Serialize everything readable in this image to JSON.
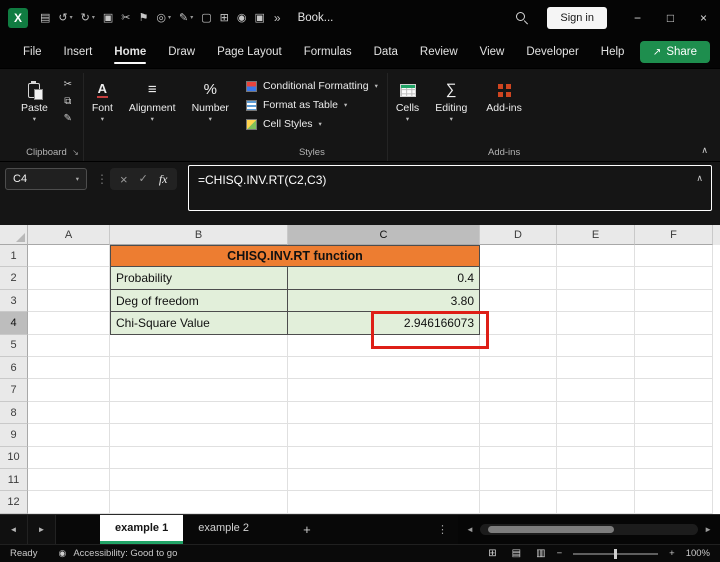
{
  "colors": {
    "excel_green": "#107C41",
    "share_green": "#1e8e4e",
    "title_orange": "#ED7D31",
    "cell_green": "#E2EFDA",
    "annotation_red": "#DE1F17",
    "tab_underline": "#21A366"
  },
  "icons": {
    "caret_down": "▾",
    "chevron_up": "∧",
    "dots_vertical": "⋮",
    "overflow": "»",
    "minimize": "−",
    "maximize": "□",
    "close": "×",
    "cancel": "×",
    "enter": "✓",
    "fx": "fx",
    "dialog_launcher": "↘",
    "nav_left": "◄",
    "nav_right": "►",
    "scroll_left": "◄",
    "scroll_right": "►",
    "add_sheet": "+",
    "zoom_out": "−",
    "zoom_in": "+",
    "share_arrow": "↗",
    "font_glyph": "A",
    "alignment_glyph": "≡",
    "number_glyph": "%",
    "editing_glyph": "∑",
    "accessibility_glyph": "◉",
    "view_normal": "⊞",
    "view_page_layout": "▤",
    "view_page_break": "▥"
  },
  "titlebar": {
    "logo_glyph": "X",
    "doc_title": "Book...",
    "sign_in_label": "Sign in",
    "quick_icons": [
      {
        "name": "save-icon",
        "glyph": "▤",
        "caret": false
      },
      {
        "name": "undo-icon",
        "glyph": "↺",
        "caret": true
      },
      {
        "name": "redo-icon",
        "glyph": "↻",
        "caret": true
      },
      {
        "name": "clipboard-icon",
        "glyph": "▣",
        "caret": false
      },
      {
        "name": "cut-icon",
        "glyph": "✂",
        "caret": false
      },
      {
        "name": "flag-icon",
        "glyph": "⚑",
        "caret": false
      },
      {
        "name": "globe-icon",
        "glyph": "◎",
        "caret": true
      },
      {
        "name": "format-painter-icon",
        "glyph": "✎",
        "caret": true
      },
      {
        "name": "document-icon",
        "glyph": "▢",
        "caret": false
      },
      {
        "name": "table-icon",
        "glyph": "⊞",
        "caret": false
      },
      {
        "name": "camera-icon",
        "glyph": "◉",
        "caret": false
      },
      {
        "name": "window-icon",
        "glyph": "▣",
        "caret": false
      }
    ]
  },
  "menubar": {
    "tabs": [
      {
        "label": "File",
        "active": false
      },
      {
        "label": "Insert",
        "active": false
      },
      {
        "label": "Home",
        "active": true
      },
      {
        "label": "Draw",
        "active": false
      },
      {
        "label": "Page Layout",
        "active": false
      },
      {
        "label": "Formulas",
        "active": false
      },
      {
        "label": "Data",
        "active": false
      },
      {
        "label": "Review",
        "active": false
      },
      {
        "label": "View",
        "active": false
      },
      {
        "label": "Developer",
        "active": false
      },
      {
        "label": "Help",
        "active": false
      }
    ],
    "share_label": "Share"
  },
  "ribbon": {
    "paste_label": "Paste",
    "clipboard_small": [
      {
        "name": "cut-button",
        "glyph": "✂"
      },
      {
        "name": "copy-button",
        "glyph": "⧉"
      },
      {
        "name": "format-painter-button",
        "glyph": "✎"
      }
    ],
    "collapsed_buttons": [
      {
        "name": "font",
        "label": "Font"
      },
      {
        "name": "alignment",
        "label": "Alignment"
      },
      {
        "name": "number",
        "label": "Number"
      }
    ],
    "styles_buttons": [
      {
        "name": "conditional-formatting",
        "label": "Conditional Formatting"
      },
      {
        "name": "format-as-table",
        "label": "Format as Table"
      },
      {
        "name": "cell-styles",
        "label": "Cell Styles"
      }
    ],
    "cells_label": "Cells",
    "editing_label": "Editing",
    "addins_label": "Add-ins",
    "group_labels": {
      "clipboard": "Clipboard",
      "styles": "Styles",
      "addins": "Add-ins"
    }
  },
  "formula_bar": {
    "name_box": "C4",
    "formula": "=CHISQ.INV.RT(C2,C3)"
  },
  "grid": {
    "column_headers": [
      "A",
      "B",
      "C",
      "D",
      "E",
      "F"
    ],
    "selected_column": "C",
    "row_headers": [
      "1",
      "2",
      "3",
      "4",
      "5",
      "6",
      "7",
      "8",
      "9",
      "10",
      "11",
      "12"
    ],
    "selected_row": "4",
    "merged_title": "CHISQ.INV.RT function",
    "data_rows": [
      {
        "row": "2",
        "label": "Probability",
        "value": "0.4"
      },
      {
        "row": "3",
        "label": "Deg of freedom",
        "value": "3.80"
      },
      {
        "row": "4",
        "label": "Chi-Square Value",
        "value": "2.946166073"
      }
    ],
    "active_cell": "C4"
  },
  "sheet_tabs": {
    "tabs": [
      {
        "label": "example 1",
        "active": true
      },
      {
        "label": "example 2",
        "active": false
      }
    ]
  },
  "status_bar": {
    "ready_label": "Ready",
    "accessibility_label": "Accessibility: Good to go",
    "zoom_percent": "100%"
  }
}
